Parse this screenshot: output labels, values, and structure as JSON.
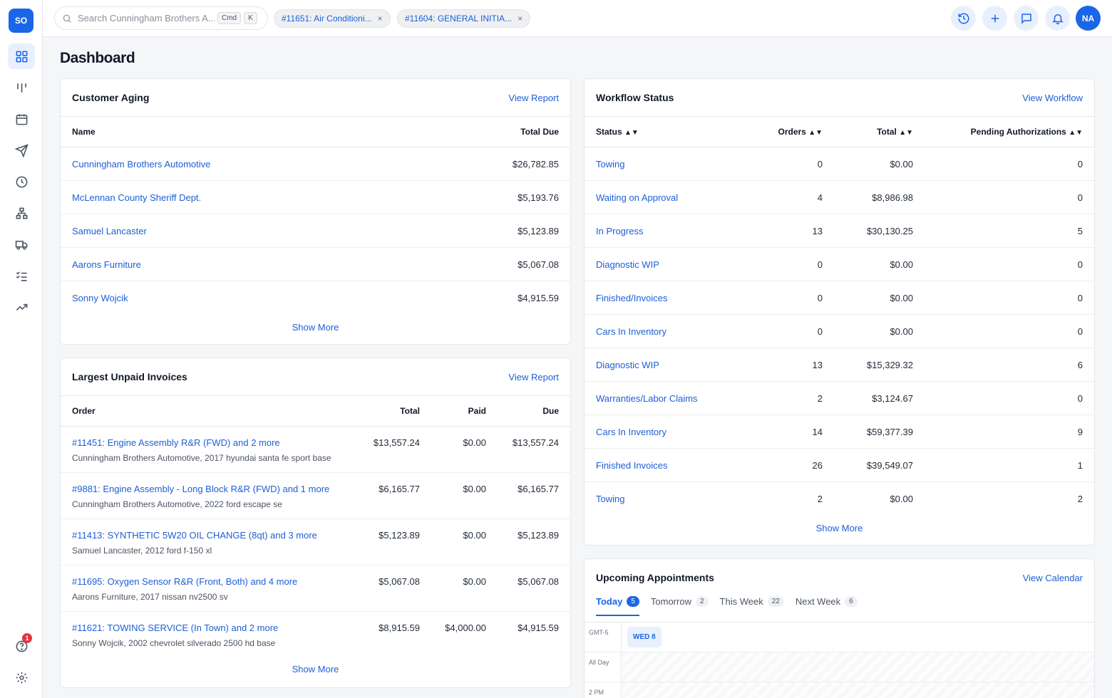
{
  "sidebar": {
    "logo": "SO",
    "help_badge": "1"
  },
  "topbar": {
    "search_placeholder": "Search Cunningham Brothers A...",
    "kbd_cmd": "Cmd",
    "kbd_k": "K",
    "chips": [
      "#11651: Air Conditioni...",
      "#11604: GENERAL INITIA..."
    ],
    "chip_close": "×",
    "avatar": "NA"
  },
  "page": {
    "title": "Dashboard"
  },
  "aging": {
    "title": "Customer Aging",
    "action": "View Report",
    "col_name": "Name",
    "col_due": "Total Due",
    "rows": [
      {
        "name": "Cunningham Brothers Automotive",
        "due": "$26,782.85"
      },
      {
        "name": "McLennan County Sheriff Dept.",
        "due": "$5,193.76"
      },
      {
        "name": "Samuel Lancaster",
        "due": "$5,123.89"
      },
      {
        "name": "Aarons Furniture",
        "due": "$5,067.08"
      },
      {
        "name": "Sonny Wojcik",
        "due": "$4,915.59"
      }
    ],
    "show_more": "Show More"
  },
  "invoices": {
    "title": "Largest Unpaid Invoices",
    "action": "View Report",
    "cols": {
      "order": "Order",
      "total": "Total",
      "paid": "Paid",
      "due": "Due"
    },
    "rows": [
      {
        "order": "#11451: Engine Assembly R&R (FWD) and 2 more",
        "sub": "Cunningham Brothers Automotive, 2017 hyundai santa fe sport base",
        "total": "$13,557.24",
        "paid": "$0.00",
        "due": "$13,557.24"
      },
      {
        "order": "#9881: Engine Assembly - Long Block R&R (FWD) and 1 more",
        "sub": "Cunningham Brothers Automotive, 2022 ford escape se",
        "total": "$6,165.77",
        "paid": "$0.00",
        "due": "$6,165.77"
      },
      {
        "order": "#11413: SYNTHETIC 5W20 OIL CHANGE (8qt) and 3 more",
        "sub": "Samuel Lancaster, 2012 ford f-150 xl",
        "total": "$5,123.89",
        "paid": "$0.00",
        "due": "$5,123.89"
      },
      {
        "order": "#11695: Oxygen Sensor R&R (Front, Both) and 4 more",
        "sub": "Aarons Furniture, 2017 nissan nv2500 sv",
        "total": "$5,067.08",
        "paid": "$0.00",
        "due": "$5,067.08"
      },
      {
        "order": "#11621: TOWING SERVICE (In Town) and 2 more",
        "sub": "Sonny Wojcik, 2002 chevrolet silverado 2500 hd base",
        "total": "$8,915.59",
        "paid": "$4,000.00",
        "due": "$4,915.59"
      }
    ],
    "show_more": "Show More"
  },
  "workflow": {
    "title": "Workflow Status",
    "action": "View Workflow",
    "cols": {
      "status": "Status",
      "orders": "Orders",
      "total": "Total",
      "pending": "Pending Authorizations"
    },
    "sort_glyph": "▲▼",
    "rows": [
      {
        "status": "Towing",
        "orders": "0",
        "total": "$0.00",
        "pending": "0"
      },
      {
        "status": "Waiting on Approval",
        "orders": "4",
        "total": "$8,986.98",
        "pending": "0"
      },
      {
        "status": "In Progress",
        "orders": "13",
        "total": "$30,130.25",
        "pending": "5"
      },
      {
        "status": "Diagnostic WIP",
        "orders": "0",
        "total": "$0.00",
        "pending": "0"
      },
      {
        "status": "Finished/Invoices",
        "orders": "0",
        "total": "$0.00",
        "pending": "0"
      },
      {
        "status": "Cars In Inventory",
        "orders": "0",
        "total": "$0.00",
        "pending": "0"
      },
      {
        "status": "Diagnostic WIP",
        "orders": "13",
        "total": "$15,329.32",
        "pending": "6"
      },
      {
        "status": "Warranties/Labor Claims",
        "orders": "2",
        "total": "$3,124.67",
        "pending": "0"
      },
      {
        "status": "Cars In Inventory",
        "orders": "14",
        "total": "$59,377.39",
        "pending": "9"
      },
      {
        "status": "Finished Invoices",
        "orders": "26",
        "total": "$39,549.07",
        "pending": "1"
      },
      {
        "status": "Towing",
        "orders": "2",
        "total": "$0.00",
        "pending": "2"
      }
    ],
    "show_more": "Show More"
  },
  "appointments": {
    "title": "Upcoming Appointments",
    "action": "View Calendar",
    "tabs": [
      {
        "label": "Today",
        "count": "5"
      },
      {
        "label": "Tomorrow",
        "count": "2"
      },
      {
        "label": "This Week",
        "count": "22"
      },
      {
        "label": "Next Week",
        "count": "6"
      }
    ],
    "timezone": "GMT-5",
    "day": "WED 8",
    "all_day": "All Day",
    "time_2pm": "2 PM"
  },
  "colors": {
    "accent": "#1a66e8",
    "link": "#1d5fd6",
    "badge": "#e5333f"
  }
}
